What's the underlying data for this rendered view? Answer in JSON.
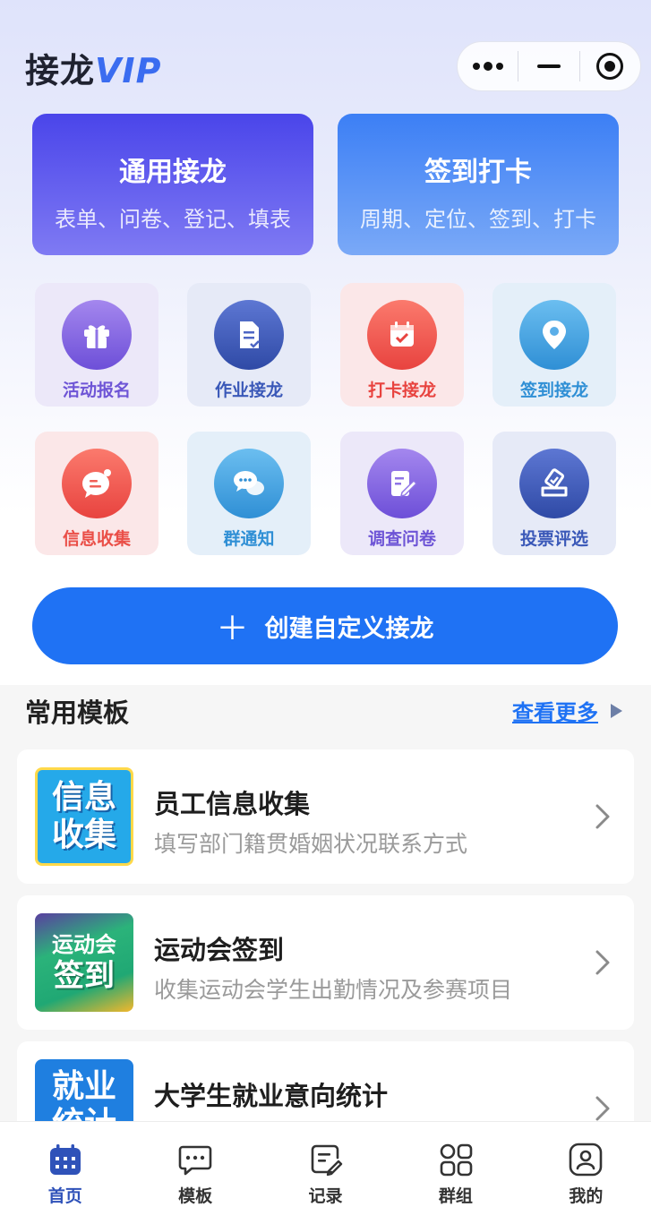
{
  "app": {
    "title_main": "接龙",
    "title_vip": "VIP"
  },
  "capsule": {
    "more_icon": "more-dots-icon",
    "minimize_icon": "minimize-icon",
    "close_icon": "target-close-icon"
  },
  "big_cards": [
    {
      "title": "通用接龙",
      "subtitle": "表单、问卷、登记、填表"
    },
    {
      "title": "签到打卡",
      "subtitle": "周期、定位、签到、打卡"
    }
  ],
  "tiles": [
    {
      "label": "活动报名",
      "icon": "gift-icon",
      "color": "#6e55d6",
      "bg": "#ece8f9"
    },
    {
      "label": "作业接龙",
      "icon": "document-icon",
      "color": "#3a58b8",
      "bg": "#e6eaf7"
    },
    {
      "label": "打卡接龙",
      "icon": "calendar-check-icon",
      "color": "#e8433f",
      "bg": "#fbe7e8"
    },
    {
      "label": "签到接龙",
      "icon": "location-pin-icon",
      "color": "#2f8fd5",
      "bg": "#e4eff9"
    },
    {
      "label": "信息收集",
      "icon": "message-bubble-icon",
      "color": "#ea4f48",
      "bg": "#fbe7e8"
    },
    {
      "label": "群通知",
      "icon": "chat-bubbles-icon",
      "color": "#2f8fd5",
      "bg": "#e4eff9"
    },
    {
      "label": "调查问卷",
      "icon": "edit-form-icon",
      "color": "#6e55d6",
      "bg": "#ece8f9"
    },
    {
      "label": "投票评选",
      "icon": "vote-icon",
      "color": "#3a58b8",
      "bg": "#e6eaf7"
    }
  ],
  "create_button": {
    "plus": "＋",
    "label": "创建自定义接龙"
  },
  "templates_section": {
    "title": "常用模板",
    "more_label": "查看更多"
  },
  "templates": [
    {
      "title": "员工信息收集",
      "desc": "填写部门籍贯婚姻状况联系方式",
      "thumb_line1": "信息",
      "thumb_line2": "收集"
    },
    {
      "title": "运动会签到",
      "desc": "收集运动会学生出勤情况及参赛项目",
      "thumb_line1": "运动会",
      "thumb_line2": "签到"
    },
    {
      "title": "大学生就业意向统计",
      "desc": "",
      "thumb_line1": "就业",
      "thumb_line2": "统计"
    }
  ],
  "tabbar": [
    {
      "label": "首页",
      "icon": "calendar-grid-icon",
      "active": true
    },
    {
      "label": "模板",
      "icon": "chat-dots-icon",
      "active": false
    },
    {
      "label": "记录",
      "icon": "record-edit-icon",
      "active": false
    },
    {
      "label": "群组",
      "icon": "grid-four-icon",
      "active": false
    },
    {
      "label": "我的",
      "icon": "user-profile-icon",
      "active": false
    }
  ],
  "colors": {
    "accent": "#1f72f4",
    "tab_active": "#2f52b9"
  }
}
